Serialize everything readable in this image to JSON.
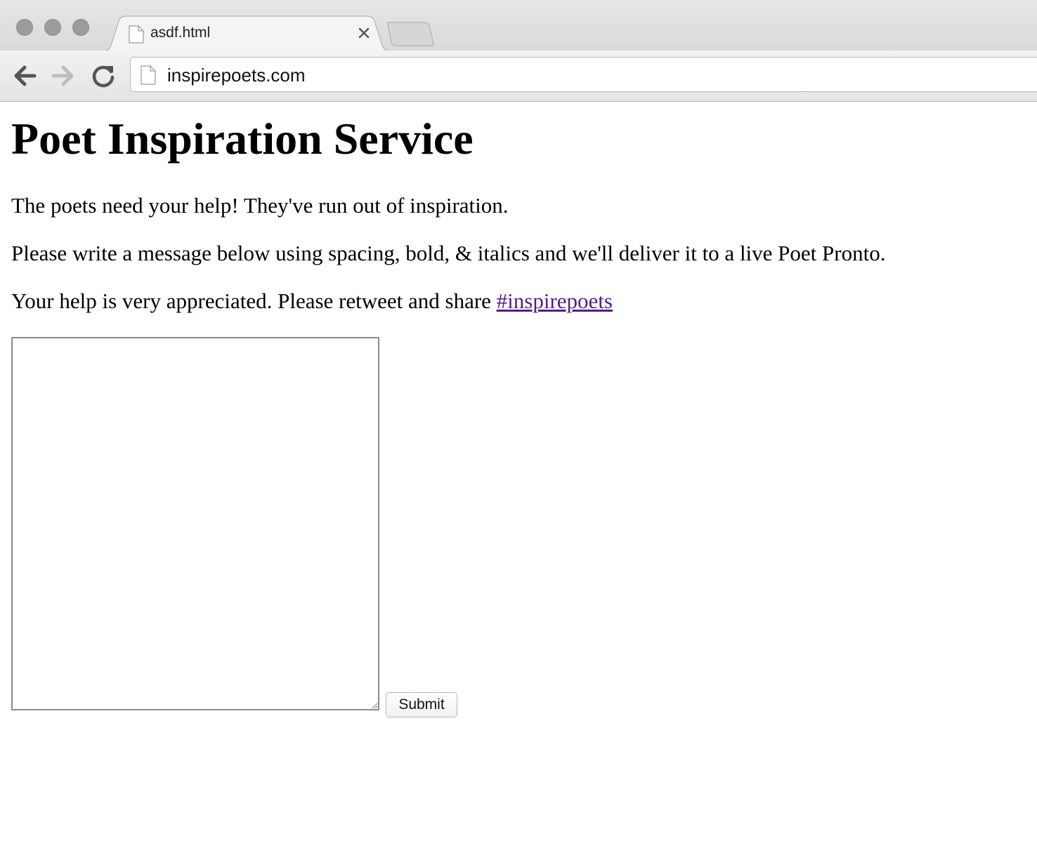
{
  "browser": {
    "tab": {
      "title": "asdf.html",
      "icon": "page-icon",
      "close_icon": "close-icon"
    },
    "toolbar": {
      "back_icon": "arrow-left-icon",
      "forward_icon": "arrow-right-icon",
      "reload_icon": "reload-icon"
    },
    "omnibox": {
      "url": "inspirepoets.com",
      "icon": "page-icon"
    }
  },
  "page": {
    "title": "Poet Inspiration Service",
    "paragraphs": {
      "p1": "The poets need your help! They've run out of inspiration.",
      "p2": "Please write a message below using spacing, bold, & italics and we'll deliver it to a live Poet Pronto.",
      "p3_text": "Your help is very appreciated. Please retweet and share ",
      "p3_link": "#inspirepoets"
    },
    "form": {
      "textarea_value": "",
      "submit_label": "Submit"
    }
  },
  "colors": {
    "link_visited": "#551a8b",
    "traffic_light": "#9c9c9c"
  }
}
